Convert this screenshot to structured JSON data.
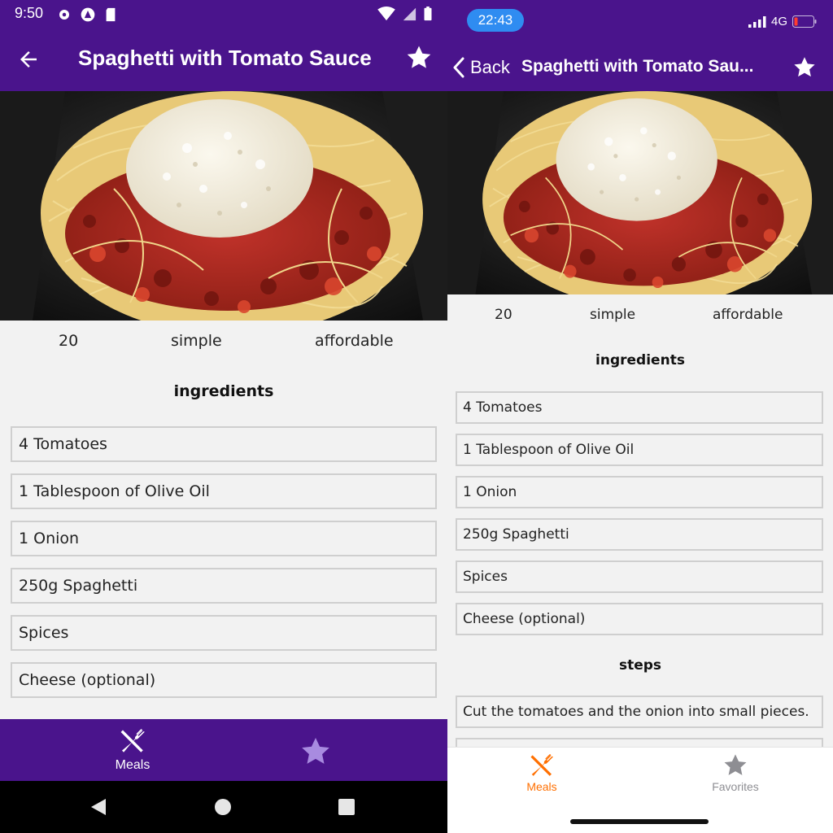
{
  "colors": {
    "primary": "#4a148c",
    "accent": "#ff6f00",
    "inactive_tab": "#8e8e93",
    "android_fav_tab": "#a88be0",
    "ios_time_pill": "#2f8cf1"
  },
  "android": {
    "status": {
      "time": "9:50"
    },
    "header": {
      "title": "Spaghetti with Tomato Sauce",
      "back_icon": "arrow-left-icon",
      "favorite_icon": "star-icon"
    },
    "meal": {
      "duration": "20",
      "complexity": "simple",
      "affordability": "affordable"
    },
    "ingredients_heading": "ingredients",
    "ingredients": [
      "4 Tomatoes",
      "1 Tablespoon of Olive Oil",
      "1 Onion",
      "250g Spaghetti",
      "Spices",
      "Cheese (optional)"
    ],
    "tabs": {
      "meals": "Meals"
    }
  },
  "ios": {
    "status": {
      "time": "22:43",
      "network": "4G"
    },
    "header": {
      "back_label": "Back",
      "title": "Spaghetti with Tomato Sau..."
    },
    "meal": {
      "duration": "20",
      "complexity": "simple",
      "affordability": "affordable"
    },
    "ingredients_heading": "ingredients",
    "ingredients": [
      "4 Tomatoes",
      "1 Tablespoon of Olive Oil",
      "1 Onion",
      "250g Spaghetti",
      "Spices",
      "Cheese (optional)"
    ],
    "steps_heading": "steps",
    "steps": [
      "Cut the tomatoes and the onion into small pieces."
    ],
    "tabs": {
      "meals": "Meals",
      "favorites": "Favorites"
    }
  }
}
